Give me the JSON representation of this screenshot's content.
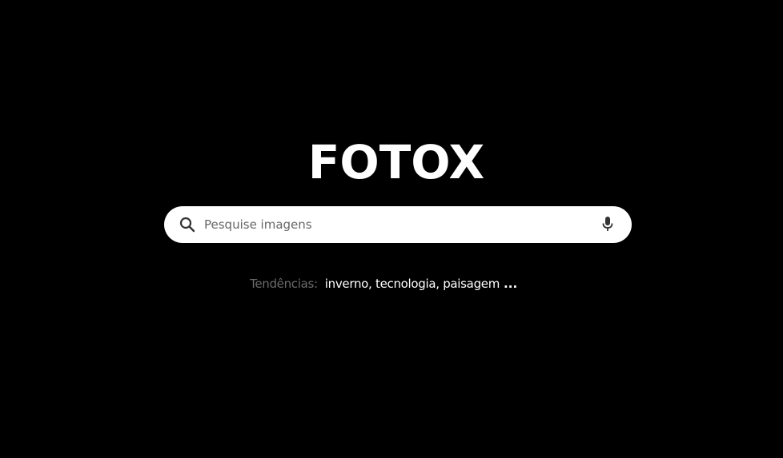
{
  "brand": {
    "logo_text": "FOTOX"
  },
  "search": {
    "placeholder": "Pesquise imagens",
    "value": "",
    "icon": "search-icon",
    "voice_icon": "microphone-icon"
  },
  "trends": {
    "label": "Tendências:",
    "items_text": "inverno, tecnologia, paisagem",
    "more": "..."
  },
  "colors": {
    "background": "#000000",
    "logo": "#ffffff",
    "search_bg": "#ffffff",
    "trends_label": "#6b6b6b",
    "trends_items": "#ffffff"
  }
}
